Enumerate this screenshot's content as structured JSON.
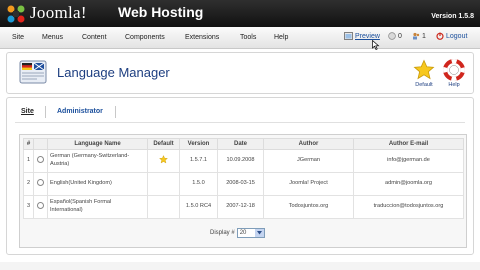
{
  "header": {
    "logo_text": "Joomla!",
    "site_name": "Web Hosting",
    "version": "Version 1.5.8"
  },
  "menubar": {
    "items": [
      "Site",
      "Menus",
      "Content",
      "Components",
      "Extensions",
      "Tools",
      "Help"
    ],
    "preview_label": "Preview",
    "messages_count": "0",
    "users_count": "1",
    "logout_label": "Logout"
  },
  "toolbar": {
    "title": "Language Manager",
    "default_label": "Default",
    "help_label": "Help"
  },
  "subtabs": {
    "site": "Site",
    "administrator": "Administrator"
  },
  "table": {
    "headers": [
      "#",
      "",
      "Language Name",
      "Default",
      "Version",
      "Date",
      "Author",
      "Author E-mail"
    ],
    "rows": [
      {
        "num": "1",
        "name": "German (Germany-Switzerland-Austria)",
        "default": true,
        "version": "1.5.7.1",
        "date": "10.09.2008",
        "author": "JGerman",
        "email": "info@jgerman.de"
      },
      {
        "num": "2",
        "name": "English(United Kingdom)",
        "default": false,
        "version": "1.5.0",
        "date": "2008-03-15",
        "author": "Joomla! Project",
        "email": "admin@joomla.org"
      },
      {
        "num": "3",
        "name": "Español(Spanish Formal International)",
        "default": false,
        "version": "1.5.0 RC4",
        "date": "2007-12-18",
        "author": "Todosjuntos.org",
        "email": "traduccion@todosjuntos.org"
      }
    ]
  },
  "pager": {
    "label": "Display #",
    "value": "20"
  },
  "colors": {
    "header_bg": "#111111",
    "link": "#1b4f9c",
    "title": "#1d3e80"
  }
}
